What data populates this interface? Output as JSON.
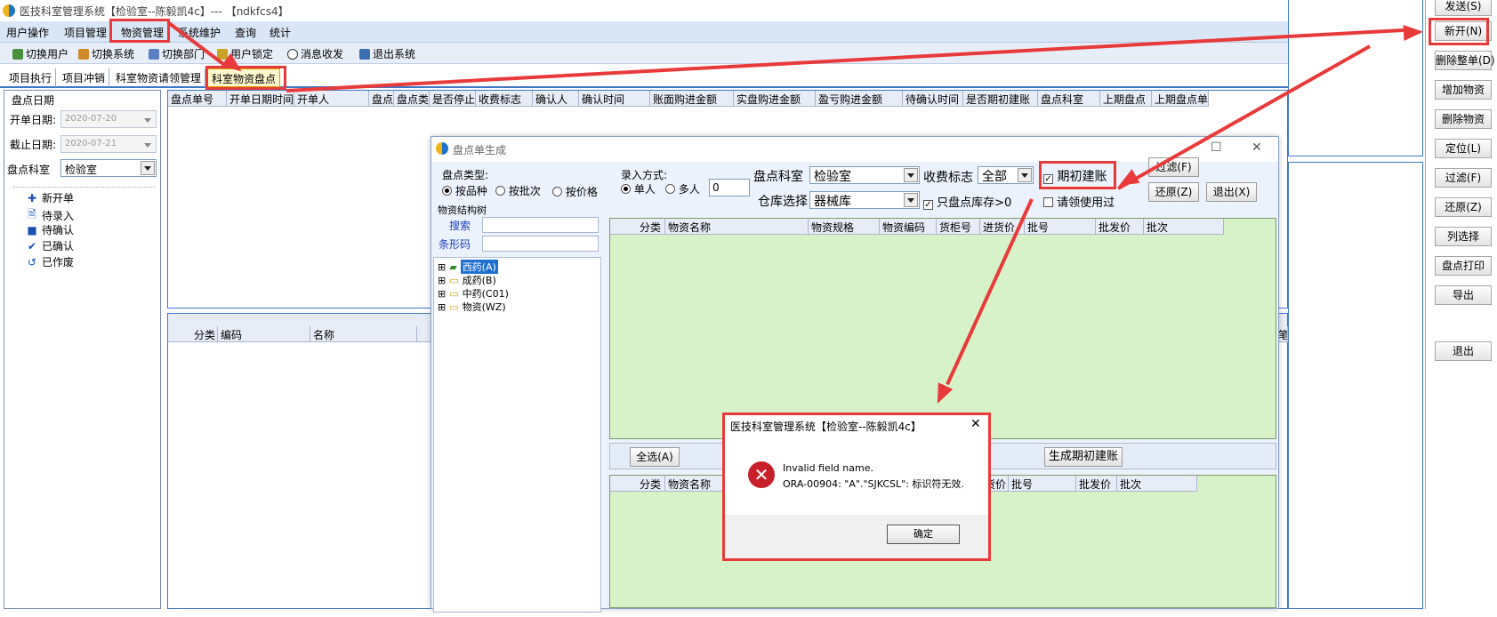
{
  "window": {
    "title": "医技科室管理系统【检验室--陈毅凯4c】--- 【ndkfcs4】"
  },
  "menu": [
    "用户操作",
    "项目管理",
    "物资管理",
    "系统维护",
    "查询",
    "统计"
  ],
  "toolbar": [
    "切换用户",
    "切换系统",
    "切换部门",
    "用户锁定",
    "消息收发",
    "退出系统"
  ],
  "tabs": [
    "项目执行",
    "项目冲销",
    "科室物资请领管理",
    "科室物资盘点"
  ],
  "left": {
    "group_title": "盘点日期",
    "start_label": "开单日期:",
    "start_value": "2020-07-20",
    "end_label": "截止日期:",
    "end_value": "2020-07-21",
    "dept_label": "盘点科室",
    "dept_value": "检验室",
    "tree": [
      "新开单",
      "待录入",
      "待确认",
      "已确认",
      "已作废"
    ]
  },
  "main_grid": {
    "columns": [
      "盘点单号",
      "开单日期时间",
      "开单人",
      "盘点",
      "盘点类",
      "是否停止",
      "收费标志",
      "确认人",
      "确认时间",
      "账面购进金额",
      "实盘购进金额",
      "盈亏购进金额",
      "待确认时间",
      "是否期初建账",
      "盘点科室",
      "上期盘点",
      "上期盘点单"
    ]
  },
  "detail_grid": {
    "columns": [
      "分类",
      "编码",
      "名称"
    ],
    "extra": "笔"
  },
  "right_buttons": [
    "发送(S)",
    "新开(N)",
    "删除整单(D)",
    "增加物资",
    "删除物资",
    "定位(L)",
    "过滤(F)",
    "还原(Z)",
    "列选择",
    "盘点打印",
    "导出",
    "退出"
  ],
  "dialog": {
    "title": "盘点单生成",
    "type_label": "盘点类型:",
    "type_options": [
      "按品种",
      "按批次",
      "按价格"
    ],
    "entry_label": "录入方式:",
    "entry_options": [
      "单人",
      "多人"
    ],
    "entry_count": "0",
    "dept_label": "盘点科室",
    "dept_value": "检验室",
    "fee_label": "收费标志",
    "fee_value": "全部",
    "opening_label": "期初建账",
    "warehouse_label": "仓库选择",
    "warehouse_value": "器械库",
    "only_stock_label": "只盘点库存>0",
    "used_label": "请领使用过",
    "filter_btn": "过滤(F)",
    "restore_btn": "还原(Z)",
    "exit_btn": "退出(X)",
    "tree_title": "物资结构树",
    "search_label": "搜索",
    "barcode_label": "条形码",
    "tree_nodes": [
      "西药(A)",
      "成药(B)",
      "中药(C01)",
      "物资(WZ)"
    ],
    "top_columns": [
      "分类",
      "物资名称",
      "物资规格",
      "物资编码",
      "货柜号",
      "进货价",
      "批号",
      "批发价",
      "批次"
    ],
    "select_all_btn": "全选(A)",
    "generate_btn": "生成期初建账",
    "bottom_columns": [
      "分类",
      "物资名称",
      "货价",
      "批号",
      "批发价",
      "批次"
    ]
  },
  "error": {
    "title": "医技科室管理系统【检验室--陈毅凯4c】",
    "line1": "Invalid field name.",
    "line2": "ORA-00904: \"A\".\"SJKCSL\": 标识符无效.",
    "ok": "确定"
  },
  "colors": {
    "annotation": "#e83a3a",
    "grid_green": "#d7f2c9",
    "accent_blue": "#3f77c7"
  }
}
